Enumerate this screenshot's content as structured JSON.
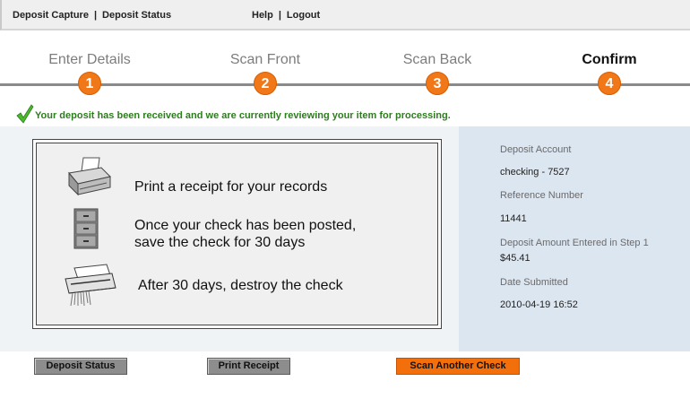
{
  "nav": {
    "deposit_capture": "Deposit Capture",
    "deposit_status": "Deposit Status",
    "help": "Help",
    "logout": "Logout",
    "separator": "|"
  },
  "steps": [
    {
      "label": "Enter Details",
      "number": "1"
    },
    {
      "label": "Scan Front",
      "number": "2"
    },
    {
      "label": "Scan Back",
      "number": "3"
    },
    {
      "label": "Confirm",
      "number": "4",
      "active": true
    }
  ],
  "message": "Your deposit has been received and we are currently reviewing your item for processing.",
  "instructions": {
    "receipt": "Print a receipt for your records",
    "save_line1": "Once your check has been posted,",
    "save_line2": "save the check for 30 days",
    "destroy": "After 30 days, destroy the check"
  },
  "summary": {
    "account_label": "Deposit Account",
    "account_value": "checking - 7527",
    "reference_label": "Reference Number",
    "reference_value": "11441",
    "amount_label": "Deposit Amount Entered in Step 1",
    "amount_value": "$45.41",
    "date_label": "Date Submitted",
    "date_value": "2010-04-19 16:52"
  },
  "buttons": {
    "deposit_status": "Deposit Status",
    "print_receipt": "Print Receipt",
    "scan_another": "Scan Another Check"
  },
  "colors": {
    "accent_orange": "#f07818",
    "success_green": "#2d7d1e",
    "summary_bg": "#dce6f1"
  },
  "icons": [
    "printer-icon",
    "file-cabinet-icon",
    "shredder-icon",
    "checkmark-icon"
  ]
}
